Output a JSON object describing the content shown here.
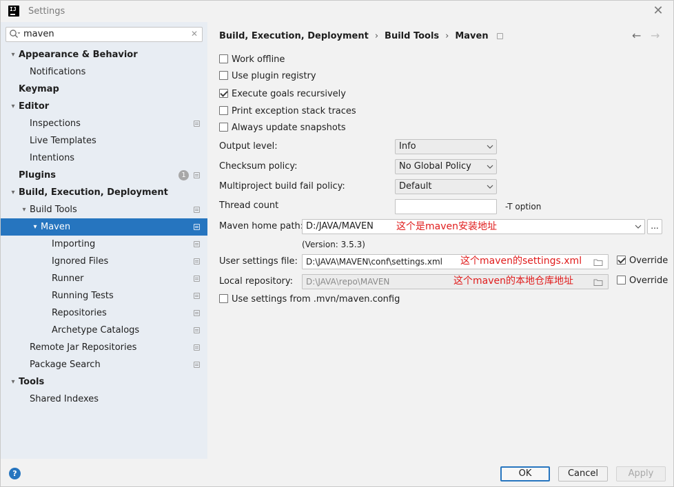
{
  "window": {
    "title": "Settings"
  },
  "search": {
    "value": "maven"
  },
  "tree": [
    {
      "label": "Appearance & Behavior",
      "bold": true,
      "level": 0,
      "arrow": "down"
    },
    {
      "label": "Notifications",
      "bold": false,
      "level": 1
    },
    {
      "label": "Keymap",
      "bold": true,
      "level": 0
    },
    {
      "label": "Editor",
      "bold": true,
      "level": 0,
      "arrow": "down"
    },
    {
      "label": "Inspections",
      "bold": false,
      "level": 1,
      "page": true
    },
    {
      "label": "Live Templates",
      "bold": false,
      "level": 1
    },
    {
      "label": "Intentions",
      "bold": false,
      "level": 1
    },
    {
      "label": "Plugins",
      "bold": true,
      "level": 0,
      "page": true,
      "badge": "1"
    },
    {
      "label": "Build, Execution, Deployment",
      "bold": true,
      "level": 0,
      "arrow": "down"
    },
    {
      "label": "Build Tools",
      "bold": false,
      "level": 1,
      "arrow": "down",
      "page": true
    },
    {
      "label": "Maven",
      "bold": false,
      "level": 2,
      "arrow": "down",
      "page": true,
      "selected": true
    },
    {
      "label": "Importing",
      "bold": false,
      "level": 3,
      "page": true
    },
    {
      "label": "Ignored Files",
      "bold": false,
      "level": 3,
      "page": true
    },
    {
      "label": "Runner",
      "bold": false,
      "level": 3,
      "page": true
    },
    {
      "label": "Running Tests",
      "bold": false,
      "level": 3,
      "page": true
    },
    {
      "label": "Repositories",
      "bold": false,
      "level": 3,
      "page": true
    },
    {
      "label": "Archetype Catalogs",
      "bold": false,
      "level": 3,
      "page": true
    },
    {
      "label": "Remote Jar Repositories",
      "bold": false,
      "level": 1,
      "page": true
    },
    {
      "label": "Package Search",
      "bold": false,
      "level": 1,
      "page": true
    },
    {
      "label": "Tools",
      "bold": true,
      "level": 0,
      "arrow": "down"
    },
    {
      "label": "Shared Indexes",
      "bold": false,
      "level": 1
    }
  ],
  "breadcrumb": {
    "part1": "Build, Execution, Deployment",
    "sep": "›",
    "part2": "Build Tools",
    "part3": "Maven"
  },
  "checkboxes": {
    "work_offline": {
      "label": "Work offline",
      "checked": false
    },
    "plugin_registry": {
      "label": "Use plugin registry",
      "checked": false
    },
    "execute_goals": {
      "label": "Execute goals recursively",
      "checked": true
    },
    "print_exception": {
      "label": "Print exception stack traces",
      "checked": false
    },
    "always_update": {
      "label": "Always update snapshots",
      "checked": false
    },
    "use_mvn_config": {
      "label": "Use settings from .mvn/maven.config",
      "checked": false
    }
  },
  "fields": {
    "output_level": {
      "label": "Output level:",
      "value": "Info"
    },
    "checksum_policy": {
      "label": "Checksum policy:",
      "value": "No Global Policy"
    },
    "fail_policy": {
      "label": "Multiproject build fail policy:",
      "value": "Default"
    },
    "thread_count": {
      "label": "Thread count",
      "value": "",
      "suffix": "-T option"
    },
    "maven_home": {
      "label": "Maven home path:",
      "value": "D:/JAVA/MAVEN",
      "browse": "...",
      "note": "这个是maven安装地址"
    },
    "version": "(Version: 3.5.3)",
    "user_settings": {
      "label": "User settings file:",
      "value": "D:\\JAVA\\MAVEN\\conf\\settings.xml",
      "note": "这个maven的settings.xml",
      "override_label": "Override",
      "override_checked": true
    },
    "local_repo": {
      "label": "Local repository:",
      "value": "D:\\JAVA\\repo\\MAVEN",
      "note": "这个maven的本地仓库地址",
      "override_label": "Override",
      "override_checked": false
    }
  },
  "footer": {
    "ok": "OK",
    "cancel": "Cancel",
    "apply": "Apply",
    "help": "?"
  },
  "colors": {
    "selection": "#2675bf",
    "sidebar_bg": "#e8edf3",
    "note_red": "#e01b1b"
  }
}
